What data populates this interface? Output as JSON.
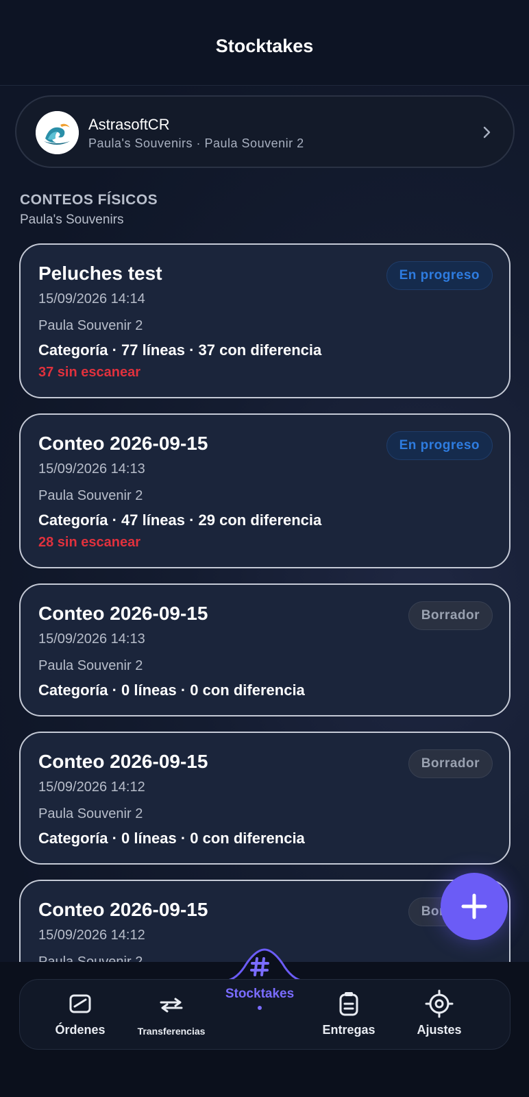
{
  "header": {
    "title": "Stocktakes"
  },
  "account": {
    "name": "AstrasoftCR",
    "subtitle": "Paula's Souvenirs · Paula Souvenir 2"
  },
  "section": {
    "title": "CONTEOS FÍSICOS",
    "subtitle": "Paula's Souvenirs"
  },
  "cards": [
    {
      "title": "Peluches test",
      "date": "15/09/2026 14:14",
      "location": "Paula Souvenir 2",
      "summary": "Categoría · 77 líneas · 37 con diferencia",
      "warning": "37 sin escanear",
      "status": "En progreso"
    },
    {
      "title": "Conteo 2026-09-15",
      "date": "15/09/2026 14:13",
      "location": "Paula Souvenir 2",
      "summary": "Categoría · 47 líneas · 29 con diferencia",
      "warning": "28 sin escanear",
      "status": "En progreso"
    },
    {
      "title": "Conteo 2026-09-15",
      "date": "15/09/2026 14:13",
      "location": "Paula Souvenir 2",
      "summary": "Categoría · 0 líneas · 0 con diferencia",
      "warning": "",
      "status": "Borrador"
    },
    {
      "title": "Conteo 2026-09-15",
      "date": "15/09/2026 14:12",
      "location": "Paula Souvenir 2",
      "summary": "Categoría · 0 líneas · 0 con diferencia",
      "warning": "",
      "status": "Borrador"
    },
    {
      "title": "Conteo 2026-09-15",
      "date": "15/09/2026 14:12",
      "location": "Paula Souvenir 2",
      "summary": "",
      "warning": "",
      "status": "Borrador"
    }
  ],
  "nav": {
    "items": [
      {
        "label": "Órdenes",
        "icon": "orders-icon"
      },
      {
        "label": "Transferencias",
        "icon": "transfer-icon"
      },
      {
        "label": "Stocktakes",
        "icon": "hash-icon",
        "active": true
      },
      {
        "label": "Entregas",
        "icon": "clipboard-icon"
      },
      {
        "label": "Ajustes",
        "icon": "settings-icon"
      }
    ]
  },
  "colors": {
    "accent": "#6b5cf6",
    "progress_badge": "#2e7ce0",
    "warning": "#e0313d",
    "card_border": "#c5cad6"
  }
}
